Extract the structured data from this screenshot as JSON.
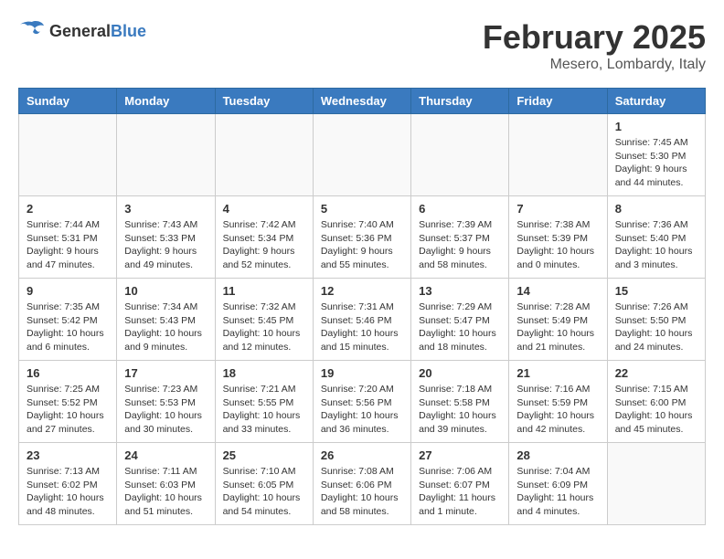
{
  "logo": {
    "general": "General",
    "blue": "Blue"
  },
  "header": {
    "month": "February 2025",
    "location": "Mesero, Lombardy, Italy"
  },
  "days_of_week": [
    "Sunday",
    "Monday",
    "Tuesday",
    "Wednesday",
    "Thursday",
    "Friday",
    "Saturday"
  ],
  "weeks": [
    [
      {
        "day": "",
        "info": ""
      },
      {
        "day": "",
        "info": ""
      },
      {
        "day": "",
        "info": ""
      },
      {
        "day": "",
        "info": ""
      },
      {
        "day": "",
        "info": ""
      },
      {
        "day": "",
        "info": ""
      },
      {
        "day": "1",
        "info": "Sunrise: 7:45 AM\nSunset: 5:30 PM\nDaylight: 9 hours and 44 minutes."
      }
    ],
    [
      {
        "day": "2",
        "info": "Sunrise: 7:44 AM\nSunset: 5:31 PM\nDaylight: 9 hours and 47 minutes."
      },
      {
        "day": "3",
        "info": "Sunrise: 7:43 AM\nSunset: 5:33 PM\nDaylight: 9 hours and 49 minutes."
      },
      {
        "day": "4",
        "info": "Sunrise: 7:42 AM\nSunset: 5:34 PM\nDaylight: 9 hours and 52 minutes."
      },
      {
        "day": "5",
        "info": "Sunrise: 7:40 AM\nSunset: 5:36 PM\nDaylight: 9 hours and 55 minutes."
      },
      {
        "day": "6",
        "info": "Sunrise: 7:39 AM\nSunset: 5:37 PM\nDaylight: 9 hours and 58 minutes."
      },
      {
        "day": "7",
        "info": "Sunrise: 7:38 AM\nSunset: 5:39 PM\nDaylight: 10 hours and 0 minutes."
      },
      {
        "day": "8",
        "info": "Sunrise: 7:36 AM\nSunset: 5:40 PM\nDaylight: 10 hours and 3 minutes."
      }
    ],
    [
      {
        "day": "9",
        "info": "Sunrise: 7:35 AM\nSunset: 5:42 PM\nDaylight: 10 hours and 6 minutes."
      },
      {
        "day": "10",
        "info": "Sunrise: 7:34 AM\nSunset: 5:43 PM\nDaylight: 10 hours and 9 minutes."
      },
      {
        "day": "11",
        "info": "Sunrise: 7:32 AM\nSunset: 5:45 PM\nDaylight: 10 hours and 12 minutes."
      },
      {
        "day": "12",
        "info": "Sunrise: 7:31 AM\nSunset: 5:46 PM\nDaylight: 10 hours and 15 minutes."
      },
      {
        "day": "13",
        "info": "Sunrise: 7:29 AM\nSunset: 5:47 PM\nDaylight: 10 hours and 18 minutes."
      },
      {
        "day": "14",
        "info": "Sunrise: 7:28 AM\nSunset: 5:49 PM\nDaylight: 10 hours and 21 minutes."
      },
      {
        "day": "15",
        "info": "Sunrise: 7:26 AM\nSunset: 5:50 PM\nDaylight: 10 hours and 24 minutes."
      }
    ],
    [
      {
        "day": "16",
        "info": "Sunrise: 7:25 AM\nSunset: 5:52 PM\nDaylight: 10 hours and 27 minutes."
      },
      {
        "day": "17",
        "info": "Sunrise: 7:23 AM\nSunset: 5:53 PM\nDaylight: 10 hours and 30 minutes."
      },
      {
        "day": "18",
        "info": "Sunrise: 7:21 AM\nSunset: 5:55 PM\nDaylight: 10 hours and 33 minutes."
      },
      {
        "day": "19",
        "info": "Sunrise: 7:20 AM\nSunset: 5:56 PM\nDaylight: 10 hours and 36 minutes."
      },
      {
        "day": "20",
        "info": "Sunrise: 7:18 AM\nSunset: 5:58 PM\nDaylight: 10 hours and 39 minutes."
      },
      {
        "day": "21",
        "info": "Sunrise: 7:16 AM\nSunset: 5:59 PM\nDaylight: 10 hours and 42 minutes."
      },
      {
        "day": "22",
        "info": "Sunrise: 7:15 AM\nSunset: 6:00 PM\nDaylight: 10 hours and 45 minutes."
      }
    ],
    [
      {
        "day": "23",
        "info": "Sunrise: 7:13 AM\nSunset: 6:02 PM\nDaylight: 10 hours and 48 minutes."
      },
      {
        "day": "24",
        "info": "Sunrise: 7:11 AM\nSunset: 6:03 PM\nDaylight: 10 hours and 51 minutes."
      },
      {
        "day": "25",
        "info": "Sunrise: 7:10 AM\nSunset: 6:05 PM\nDaylight: 10 hours and 54 minutes."
      },
      {
        "day": "26",
        "info": "Sunrise: 7:08 AM\nSunset: 6:06 PM\nDaylight: 10 hours and 58 minutes."
      },
      {
        "day": "27",
        "info": "Sunrise: 7:06 AM\nSunset: 6:07 PM\nDaylight: 11 hours and 1 minute."
      },
      {
        "day": "28",
        "info": "Sunrise: 7:04 AM\nSunset: 6:09 PM\nDaylight: 11 hours and 4 minutes."
      },
      {
        "day": "",
        "info": ""
      }
    ]
  ]
}
